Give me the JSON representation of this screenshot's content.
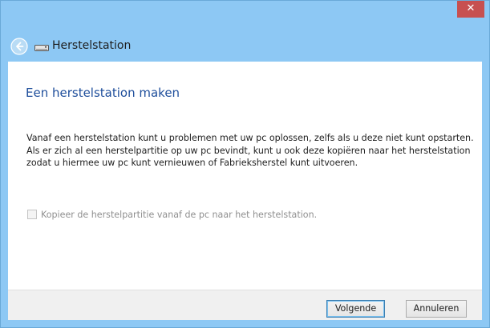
{
  "window": {
    "close_label": "✕"
  },
  "nav": {
    "title": "Herstelstation"
  },
  "content": {
    "heading": "Een herstelstation maken",
    "description": "Vanaf een herstelstation kunt u problemen met uw pc oplossen, zelfs als u deze niet kunt opstarten. Als er zich al een herstelpartitie op uw pc bevindt, kunt u ook deze kopiëren naar het herstelstation zodat u hiermee uw pc kunt vernieuwen of Fabrieksherstel kunt uitvoeren.",
    "checkbox_label": "Kopieer de herstelpartitie vanaf de pc naar het herstelstation.",
    "checkbox_checked": false,
    "checkbox_disabled": true
  },
  "footer": {
    "next_label": "Volgende",
    "cancel_label": "Annuleren"
  },
  "colors": {
    "titlebar": "#8dc8f4",
    "close_button": "#c75050",
    "heading": "#1e4e9b",
    "disabled_text": "#8f8f8f"
  },
  "icons": {
    "back": "back-arrow-icon",
    "drive": "drive-icon",
    "close": "close-icon"
  }
}
